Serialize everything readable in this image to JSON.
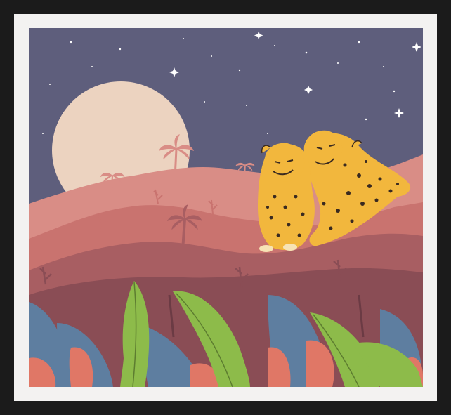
{
  "artwork": {
    "subject": "two-cheetahs-under-moon",
    "colors": {
      "frame": "#1b1b1b",
      "mat": "#f3f2f1",
      "sky": "#5e5e7c",
      "moon": "#ecd3c0",
      "hills_far": "#d98d86",
      "hills_mid": "#c9736f",
      "hills_near": "#a85e62",
      "ground": "#8a4d55",
      "cheetah_fur": "#f2b73d",
      "leaf_green": "#8dbb4a",
      "leaf_blue": "#5e7ea0",
      "leaf_red": "#e07766"
    }
  }
}
